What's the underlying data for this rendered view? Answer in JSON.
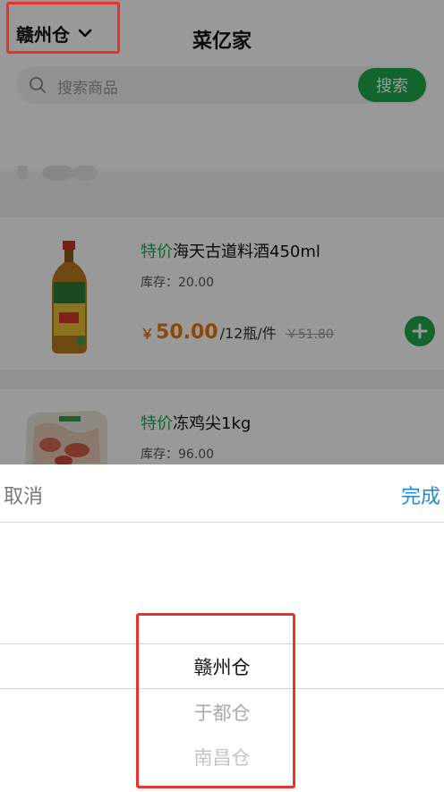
{
  "header": {
    "warehouse": "赣州仓",
    "title": "菜亿家",
    "search_placeholder": "搜索商品",
    "search_button": "搜索"
  },
  "products": [
    {
      "tag": "特价",
      "name": "海天古道料酒450ml",
      "stock": "库存：20.00",
      "price_symbol": "￥",
      "price": "50.00",
      "unit": "/12瓶/件",
      "old_price": "￥51.80"
    },
    {
      "tag": "特价",
      "name": "冻鸡尖1kg",
      "stock": "库存：96.00"
    }
  ],
  "picker": {
    "cancel_label": "取消",
    "done_label": "完成",
    "options": [
      "赣州仓",
      "于都仓",
      "南昌仓"
    ],
    "selected": "赣州仓"
  },
  "colors": {
    "accent_green": "#1fa84a",
    "price_orange": "#e8780c",
    "done_blue": "#1c8cd6",
    "highlight_red": "#e8322b"
  },
  "icons": {
    "warehouse_dropdown": "chevron-down-icon",
    "search": "search-icon",
    "add_to_cart": "plus-icon"
  }
}
